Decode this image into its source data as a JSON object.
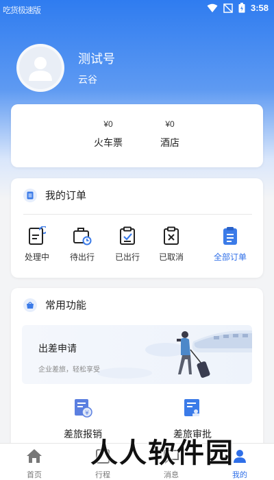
{
  "status": {
    "left_text": "吃货极速版",
    "time": "3:58"
  },
  "profile": {
    "name": "测试号",
    "company": "云谷"
  },
  "wallet": [
    {
      "amount": "¥0",
      "label": "火车票"
    },
    {
      "amount": "¥0",
      "label": "酒店"
    }
  ],
  "orders": {
    "title": "我的订单",
    "items": [
      {
        "label": "处理中"
      },
      {
        "label": "待出行"
      },
      {
        "label": "已出行"
      },
      {
        "label": "已取消"
      },
      {
        "label": "全部订单"
      }
    ]
  },
  "functions": {
    "title": "常用功能",
    "banner_title": "出差申请",
    "banner_sub": "企业差旅，轻松享受",
    "items": [
      {
        "label": "差旅报销"
      },
      {
        "label": "差旅审批"
      }
    ]
  },
  "tabs": [
    {
      "label": "首页"
    },
    {
      "label": "行程"
    },
    {
      "label": "消息"
    },
    {
      "label": "我的"
    }
  ],
  "watermark": "人人软件园",
  "colors": {
    "accent": "#2f6fe8",
    "hero_top": "#2f7cf0"
  }
}
